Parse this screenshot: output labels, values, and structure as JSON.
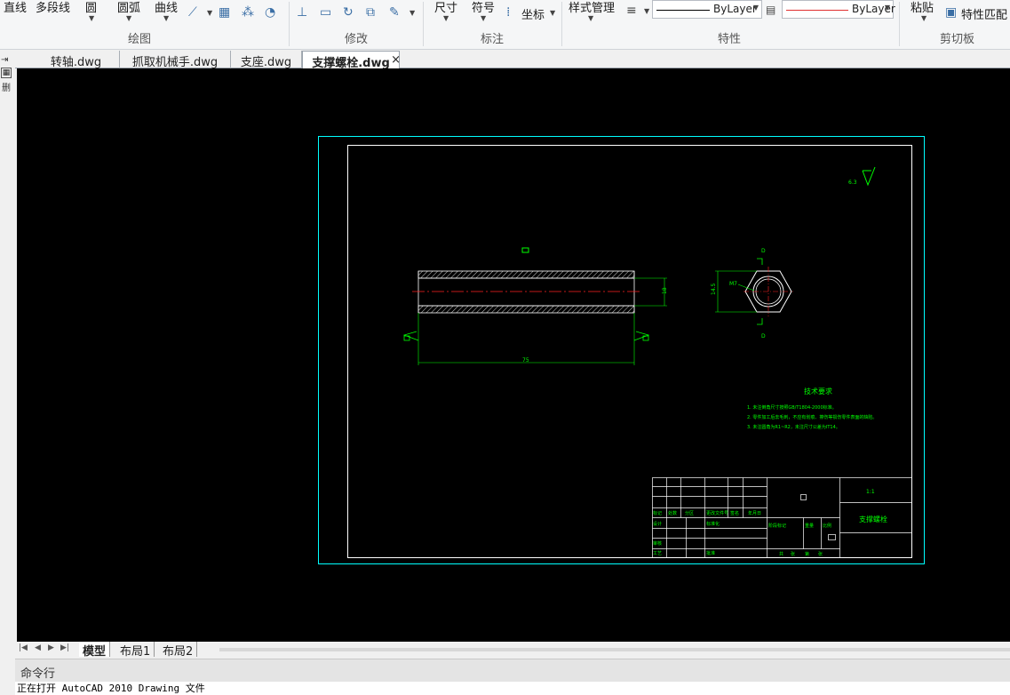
{
  "ribbon": {
    "draw": {
      "line": "直线",
      "polyline": "多段线",
      "circle": "圆",
      "arc": "圆弧",
      "curve": "曲线",
      "group": "绘图"
    },
    "modify": {
      "group": "修改"
    },
    "annotate": {
      "dimension": "尺寸",
      "symbol": "符号",
      "coordinate": "坐标",
      "group": "标注"
    },
    "properties": {
      "style": "样式管理",
      "linetype": "ByLayer",
      "color": "ByLayer",
      "group": "特性",
      "color_hex": "#e03030"
    },
    "clipboard": {
      "paste": "粘贴",
      "match": "特性匹配",
      "group": "剪切板"
    }
  },
  "left_strip": {
    "label": "删"
  },
  "file_tabs": [
    {
      "label": "转轴.dwg"
    },
    {
      "label": "抓取机械手.dwg"
    },
    {
      "label": "支座.dwg"
    },
    {
      "label": "支撑螺栓.dwg",
      "active": true
    }
  ],
  "close_glyph": "×",
  "drawing": {
    "dim_length": "75",
    "dim_dia": "18",
    "dim_hex": "14.5",
    "dim_hole": "M7",
    "section_mark": "D",
    "roughness": "6.3",
    "tech_title": "技术要求",
    "tech_notes": [
      "1. 未注倒角尺寸按照GB/T1804-2000标准。",
      "2. 零件加工后去毛刺，不应有划痕、擦伤等损伤零件表面的缺陷。",
      "3. 未注圆角为R1~R2，未注尺寸公差为IT14。"
    ],
    "title_block": {
      "part_name": "支撑螺栓",
      "scale": "1:1",
      "cells": [
        "标记",
        "处数",
        "分区",
        "更改文件号",
        "签名",
        "年月日",
        "设计",
        "标准化",
        "阶段标记",
        "重量",
        "比例",
        "审核",
        "工艺",
        "批准",
        "共",
        "张",
        "第",
        "张"
      ]
    },
    "colors": {
      "border": "#00ffff",
      "frame": "#ffffff",
      "geometry": "#00ff00",
      "center": "#ff2020",
      "hatch": "#ffffff"
    }
  },
  "layout_tabs": [
    {
      "label": "模型",
      "active": true
    },
    {
      "label": "布局1"
    },
    {
      "label": "布局2"
    }
  ],
  "command": {
    "label": "命令行",
    "status": "正在打开 AutoCAD 2010 Drawing 文件"
  }
}
